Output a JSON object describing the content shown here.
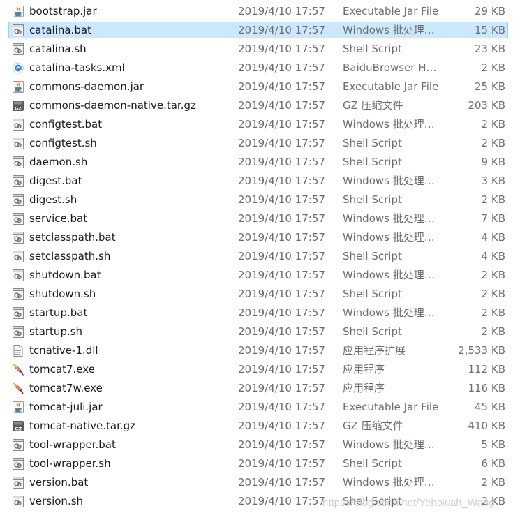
{
  "files": [
    {
      "name": "bootstrap.jar",
      "modified": "2019/4/10 17:57",
      "type": "Executable Jar File",
      "size": "29 KB",
      "icon": "java-jar-icon",
      "selected": false
    },
    {
      "name": "catalina.bat",
      "modified": "2019/4/10 17:57",
      "type": "Windows 批处理…",
      "size": "15 KB",
      "icon": "script-file-icon",
      "selected": true
    },
    {
      "name": "catalina.sh",
      "modified": "2019/4/10 17:57",
      "type": "Shell Script",
      "size": "23 KB",
      "icon": "script-file-icon",
      "selected": false
    },
    {
      "name": "catalina-tasks.xml",
      "modified": "2019/4/10 17:57",
      "type": "BaiduBrowser H…",
      "size": "2 KB",
      "icon": "browser-xml-icon",
      "selected": false
    },
    {
      "name": "commons-daemon.jar",
      "modified": "2019/4/10 17:57",
      "type": "Executable Jar File",
      "size": "25 KB",
      "icon": "java-jar-icon",
      "selected": false
    },
    {
      "name": "commons-daemon-native.tar.gz",
      "modified": "2019/4/10 17:57",
      "type": "GZ 压缩文件",
      "size": "203 KB",
      "icon": "gz-archive-icon",
      "selected": false
    },
    {
      "name": "configtest.bat",
      "modified": "2019/4/10 17:57",
      "type": "Windows 批处理…",
      "size": "2 KB",
      "icon": "script-file-icon",
      "selected": false
    },
    {
      "name": "configtest.sh",
      "modified": "2019/4/10 17:57",
      "type": "Shell Script",
      "size": "2 KB",
      "icon": "script-file-icon",
      "selected": false
    },
    {
      "name": "daemon.sh",
      "modified": "2019/4/10 17:57",
      "type": "Shell Script",
      "size": "9 KB",
      "icon": "script-file-icon",
      "selected": false
    },
    {
      "name": "digest.bat",
      "modified": "2019/4/10 17:57",
      "type": "Windows 批处理…",
      "size": "3 KB",
      "icon": "script-file-icon",
      "selected": false
    },
    {
      "name": "digest.sh",
      "modified": "2019/4/10 17:57",
      "type": "Shell Script",
      "size": "2 KB",
      "icon": "script-file-icon",
      "selected": false
    },
    {
      "name": "service.bat",
      "modified": "2019/4/10 17:57",
      "type": "Windows 批处理…",
      "size": "7 KB",
      "icon": "script-file-icon",
      "selected": false
    },
    {
      "name": "setclasspath.bat",
      "modified": "2019/4/10 17:57",
      "type": "Windows 批处理…",
      "size": "4 KB",
      "icon": "script-file-icon",
      "selected": false
    },
    {
      "name": "setclasspath.sh",
      "modified": "2019/4/10 17:57",
      "type": "Shell Script",
      "size": "4 KB",
      "icon": "script-file-icon",
      "selected": false
    },
    {
      "name": "shutdown.bat",
      "modified": "2019/4/10 17:57",
      "type": "Windows 批处理…",
      "size": "2 KB",
      "icon": "script-file-icon",
      "selected": false
    },
    {
      "name": "shutdown.sh",
      "modified": "2019/4/10 17:57",
      "type": "Shell Script",
      "size": "2 KB",
      "icon": "script-file-icon",
      "selected": false
    },
    {
      "name": "startup.bat",
      "modified": "2019/4/10 17:57",
      "type": "Windows 批处理…",
      "size": "2 KB",
      "icon": "script-file-icon",
      "selected": false
    },
    {
      "name": "startup.sh",
      "modified": "2019/4/10 17:57",
      "type": "Shell Script",
      "size": "2 KB",
      "icon": "script-file-icon",
      "selected": false
    },
    {
      "name": "tcnative-1.dll",
      "modified": "2019/4/10 17:57",
      "type": "应用程序扩展",
      "size": "2,533 KB",
      "icon": "dll-file-icon",
      "selected": false
    },
    {
      "name": "tomcat7.exe",
      "modified": "2019/4/10 17:57",
      "type": "应用程序",
      "size": "112 KB",
      "icon": "tomcat-feather-icon",
      "selected": false
    },
    {
      "name": "tomcat7w.exe",
      "modified": "2019/4/10 17:57",
      "type": "应用程序",
      "size": "116 KB",
      "icon": "tomcat-feather-icon",
      "selected": false
    },
    {
      "name": "tomcat-juli.jar",
      "modified": "2019/4/10 17:57",
      "type": "Executable Jar File",
      "size": "45 KB",
      "icon": "java-jar-icon",
      "selected": false
    },
    {
      "name": "tomcat-native.tar.gz",
      "modified": "2019/4/10 17:57",
      "type": "GZ 压缩文件",
      "size": "410 KB",
      "icon": "gz-archive-icon",
      "selected": false
    },
    {
      "name": "tool-wrapper.bat",
      "modified": "2019/4/10 17:57",
      "type": "Windows 批处理…",
      "size": "5 KB",
      "icon": "script-file-icon",
      "selected": false
    },
    {
      "name": "tool-wrapper.sh",
      "modified": "2019/4/10 17:57",
      "type": "Shell Script",
      "size": "6 KB",
      "icon": "script-file-icon",
      "selected": false
    },
    {
      "name": "version.bat",
      "modified": "2019/4/10 17:57",
      "type": "Windows 批处理…",
      "size": "2 KB",
      "icon": "script-file-icon",
      "selected": false
    },
    {
      "name": "version.sh",
      "modified": "2019/4/10 17:57",
      "type": "Shell Script",
      "size": "2 KB",
      "icon": "script-file-icon",
      "selected": false
    }
  ],
  "watermark": "https://blog.csdn.net/Yehowah_Wang",
  "colors": {
    "selection_bg": "#cce8ff",
    "selection_border": "#99d1ff",
    "meta_text": "#6d6d6d"
  }
}
